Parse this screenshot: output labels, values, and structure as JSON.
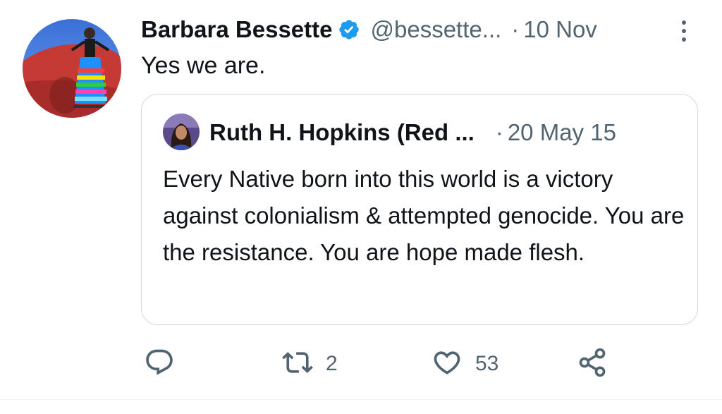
{
  "tweet": {
    "author": {
      "display_name": "Barbara Bessette",
      "handle": "@bessette...",
      "verified": true
    },
    "separator": "·",
    "date": "10 Nov",
    "text": "Yes we are.",
    "quoted": {
      "author_name": "Ruth H. Hopkins (Red ...",
      "separator": "·",
      "date": "20 May 15",
      "text": "Every Native born into this world is a victory against colonialism & attempted genocide. You are the resistance. You are hope made flesh."
    },
    "actions": {
      "reply_count": "",
      "retweet_count": "2",
      "like_count": "53"
    }
  },
  "icons": {
    "verified": "verified-badge-icon",
    "more": "more-vertical-icon",
    "reply": "reply-icon",
    "retweet": "retweet-icon",
    "like": "heart-icon",
    "share": "share-icon"
  },
  "colors": {
    "text_primary": "#0f1419",
    "text_secondary": "#536471",
    "verified_blue": "#1d9bf0",
    "border": "#cfd9de"
  }
}
